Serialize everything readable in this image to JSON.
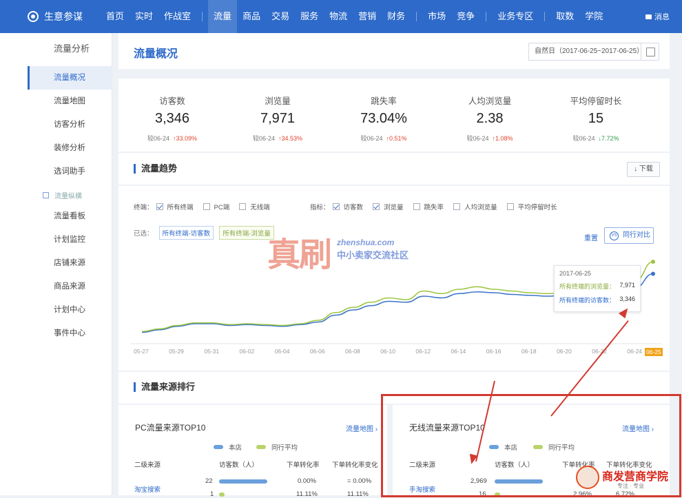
{
  "nav": {
    "app_name": "生意参谋",
    "items": [
      "首页",
      "实时",
      "作战室",
      "流量",
      "商品",
      "交易",
      "服务",
      "物流",
      "营销",
      "财务",
      "市场",
      "竞争",
      "业务专区",
      "取数",
      "学院"
    ],
    "message": "消息"
  },
  "sidebar": {
    "title": "流量分析",
    "items": [
      "流量概况",
      "流量地图",
      "访客分析",
      "装修分析",
      "选词助手"
    ],
    "group": "流量纵横",
    "group_items": [
      "流量看板",
      "计划监控",
      "店铺来源",
      "商品来源",
      "计划中心",
      "事件中心"
    ]
  },
  "header": {
    "title": "流量概况",
    "date_range": "自然日（2017-06-25~2017-06-25）"
  },
  "kpis": [
    {
      "label": "访客数",
      "value": "3,346",
      "compare": "较06-24",
      "change": "33.09%",
      "dir": "up"
    },
    {
      "label": "浏览量",
      "value": "7,971",
      "compare": "较06-24",
      "change": "34.53%",
      "dir": "up"
    },
    {
      "label": "跳失率",
      "value": "73.04%",
      "compare": "较06-24",
      "change": "0.51%",
      "dir": "up"
    },
    {
      "label": "人均浏览量",
      "value": "2.38",
      "compare": "较06-24",
      "change": "1.08%",
      "dir": "up"
    },
    {
      "label": "平均停留时长",
      "value": "15",
      "compare": "较06-24",
      "change": "7.72%",
      "dir": "down"
    }
  ],
  "trend": {
    "title": "流量趋势",
    "download": "下载",
    "terminal_label": "终端：",
    "terminals": [
      {
        "label": "所有终端",
        "checked": true
      },
      {
        "label": "PC端",
        "checked": false
      },
      {
        "label": "无线端",
        "checked": false
      }
    ],
    "metric_label": "指标：",
    "metrics": [
      {
        "label": "访客数",
        "checked": true
      },
      {
        "label": "浏览量",
        "checked": true
      },
      {
        "label": "跳失率",
        "checked": false
      },
      {
        "label": "人均浏览量",
        "checked": false
      },
      {
        "label": "平均停留时长",
        "checked": false
      }
    ],
    "selected_label": "已选：",
    "selected": [
      "所有终端-访客数",
      "所有终端-浏览量"
    ],
    "reset": "重置",
    "peer_compare": "同行对比",
    "peer_icon": "VS",
    "tooltip": {
      "date": "2017-06-25",
      "rows": [
        {
          "label": "所有终端的浏览量：",
          "value": "7,971"
        },
        {
          "label": "所有终端的访客数：",
          "value": "3,346"
        }
      ]
    }
  },
  "chart_data": {
    "type": "line",
    "x": [
      "05-27",
      "05-28",
      "05-29",
      "05-30",
      "05-31",
      "06-01",
      "06-02",
      "06-03",
      "06-04",
      "06-05",
      "06-06",
      "06-07",
      "06-08",
      "06-09",
      "06-10",
      "06-11",
      "06-12",
      "06-13",
      "06-14",
      "06-15",
      "06-16",
      "06-17",
      "06-18",
      "06-19",
      "06-20",
      "06-21",
      "06-22",
      "06-23",
      "06-24",
      "06-25"
    ],
    "xtick_labels": [
      "05-27",
      "05-29",
      "05-31",
      "06-02",
      "06-04",
      "06-06",
      "06-08",
      "06-10",
      "06-12",
      "06-14",
      "06-16",
      "06-18",
      "06-20",
      "06-22",
      "06-24",
      "06-25"
    ],
    "series": [
      {
        "name": "所有终端-访客数",
        "color": "#3a73c8",
        "values": [
          0.1,
          0.13,
          0.17,
          0.2,
          0.2,
          0.18,
          0.19,
          0.18,
          0.17,
          0.19,
          0.22,
          0.3,
          0.36,
          0.41,
          0.46,
          0.45,
          0.52,
          0.5,
          0.55,
          0.57,
          0.56,
          0.54,
          0.53,
          0.52,
          0.53,
          0.51,
          0.55,
          0.57,
          0.62,
          0.78
        ]
      },
      {
        "name": "所有终端-浏览量",
        "color": "#9dc541",
        "values": [
          0.11,
          0.14,
          0.18,
          0.21,
          0.21,
          0.19,
          0.2,
          0.19,
          0.18,
          0.2,
          0.24,
          0.33,
          0.39,
          0.45,
          0.5,
          0.48,
          0.58,
          0.55,
          0.6,
          0.63,
          0.6,
          0.58,
          0.56,
          0.55,
          0.56,
          0.54,
          0.58,
          0.62,
          0.7,
          0.92
        ]
      }
    ],
    "ylim": [
      0,
      1
    ],
    "grid": false,
    "highlight_x": "06-25"
  },
  "sources": {
    "title": "流量来源排行",
    "pc": {
      "title": "PC流量来源TOP10",
      "link": "流量地图",
      "legend": [
        "本店",
        "同行平均"
      ],
      "headers": [
        "二级来源",
        "访客数（人）",
        "下单转化率",
        "下单转化率变化"
      ],
      "rows": [
        {
          "source": "淘宝搜索",
          "visitors": "22",
          "rate": "0.00%",
          "change": "0.00%",
          "bar": 0.85
        },
        {
          "source": "",
          "visitors": "1",
          "rate": "11.11%",
          "change": "11.11%",
          "bar": 0.1
        }
      ]
    },
    "mobile": {
      "title": "无线流量来源TOP10",
      "link": "流量地图",
      "legend": [
        "本店",
        "同行平均"
      ],
      "headers": [
        "二级来源",
        "访客数（人）",
        "下单转化率",
        "下单转化率变化"
      ],
      "rows": [
        {
          "source": "手淘搜索",
          "visitors": "2,969",
          "rate": "",
          "change": "",
          "bar": 0.85
        },
        {
          "source": "",
          "visitors": "16",
          "rate": "2.96%",
          "change": "6.72%",
          "bar": 0.1
        }
      ]
    }
  },
  "watermark": {
    "main": "真刷",
    "url": "zhenshua.com",
    "sub": "中小卖家交流社区"
  },
  "badge": {
    "title": "商发营商学院",
    "sub": "专注 · 专业"
  }
}
